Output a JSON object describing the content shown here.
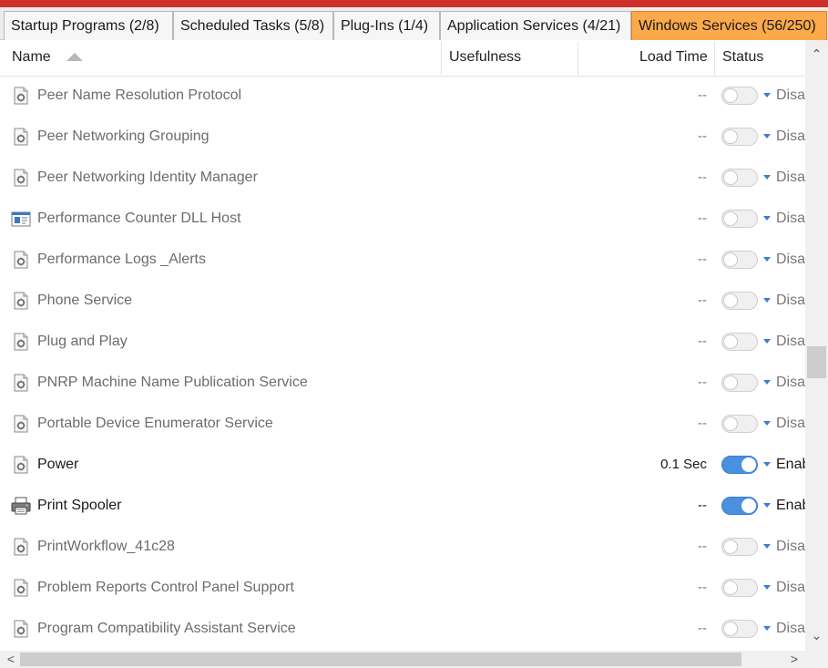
{
  "tabs": [
    {
      "label": "Startup Programs (2/8)",
      "active": false
    },
    {
      "label": "Scheduled Tasks (5/8)",
      "active": false
    },
    {
      "label": "Plug-Ins (1/4)",
      "active": false
    },
    {
      "label": "Application Services (4/21)",
      "active": false
    },
    {
      "label": "Windows Services (56/250)",
      "active": true
    }
  ],
  "columns": {
    "name": "Name",
    "usefulness": "Usefulness",
    "load_time": "Load Time",
    "status": "Status"
  },
  "rows": [
    {
      "icon": "service-icon",
      "name": "Peer Name Resolution Protocol",
      "load_time": "--",
      "enabled": false,
      "status": "Disa"
    },
    {
      "icon": "service-icon",
      "name": "Peer Networking Grouping",
      "load_time": "--",
      "enabled": false,
      "status": "Disa"
    },
    {
      "icon": "service-icon",
      "name": "Peer Networking Identity Manager",
      "load_time": "--",
      "enabled": false,
      "status": "Disa"
    },
    {
      "icon": "window-icon",
      "name": "Performance Counter DLL Host",
      "load_time": "--",
      "enabled": false,
      "status": "Disa"
    },
    {
      "icon": "service-icon",
      "name": "Performance Logs _Alerts",
      "load_time": "--",
      "enabled": false,
      "status": "Disa"
    },
    {
      "icon": "service-icon",
      "name": "Phone Service",
      "load_time": "--",
      "enabled": false,
      "status": "Disa"
    },
    {
      "icon": "service-icon",
      "name": "Plug and Play",
      "load_time": "--",
      "enabled": false,
      "status": "Disa"
    },
    {
      "icon": "service-icon",
      "name": "PNRP Machine Name Publication Service",
      "load_time": "--",
      "enabled": false,
      "status": "Disa"
    },
    {
      "icon": "service-icon",
      "name": "Portable Device Enumerator Service",
      "load_time": "--",
      "enabled": false,
      "status": "Disa"
    },
    {
      "icon": "service-icon",
      "name": "Power",
      "load_time": "0.1 Sec",
      "enabled": true,
      "status": "Enab"
    },
    {
      "icon": "printer-icon",
      "name": "Print Spooler",
      "load_time": "--",
      "enabled": true,
      "status": "Enab"
    },
    {
      "icon": "service-icon",
      "name": "PrintWorkflow_41c28",
      "load_time": "--",
      "enabled": false,
      "status": "Disa"
    },
    {
      "icon": "service-icon",
      "name": "Problem Reports Control Panel Support",
      "load_time": "--",
      "enabled": false,
      "status": "Disa"
    },
    {
      "icon": "service-icon",
      "name": "Program Compatibility Assistant Service",
      "load_time": "--",
      "enabled": false,
      "status": "Disa"
    }
  ],
  "colors": {
    "accent_tab": "#fba94b",
    "toggle_on": "#4a8fe0",
    "top_strip": "#d0302a"
  }
}
